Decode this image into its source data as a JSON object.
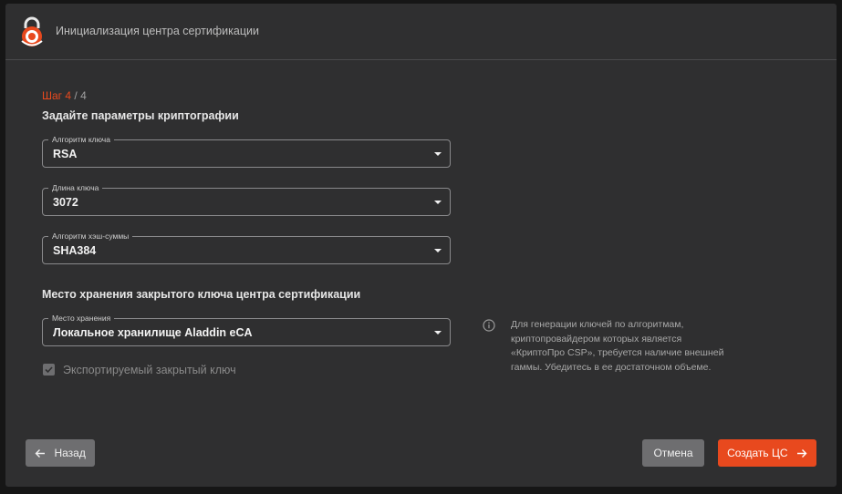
{
  "header": {
    "title": "Инициализация центра сертификации",
    "logo_icon": "lock-logo-icon"
  },
  "step": {
    "label": "Шаг 4",
    "total": "/ 4"
  },
  "crypto_section": {
    "title": "Задайте параметры криптографии",
    "fields": [
      {
        "legend": "Алгоритм ключа",
        "value": "RSA"
      },
      {
        "legend": "Длина ключа",
        "value": "3072"
      },
      {
        "legend": "Алгоритм хэш-суммы",
        "value": "SHA384"
      }
    ]
  },
  "storage_section": {
    "title": "Место хранения закрытого ключа центра сертификации",
    "field": {
      "legend": "Место хранения",
      "value": "Локальное хранилище Aladdin eCA"
    },
    "checkbox": {
      "label": "Экспортируемый закрытый ключ",
      "checked": true,
      "disabled": true
    }
  },
  "info": {
    "icon": "info-icon",
    "text": "Для генерации ключей по алгоритмам, криптопровайдером которых является «КриптоПро CSP», требуется наличие внешней гаммы. Убедитесь в ее достаточном объеме."
  },
  "buttons": {
    "back": "Назад",
    "cancel": "Отмена",
    "create": "Создать ЦС"
  },
  "colors": {
    "accent": "#e8491e",
    "background": "#2f2f30",
    "secondary_button": "#6e6e70"
  }
}
